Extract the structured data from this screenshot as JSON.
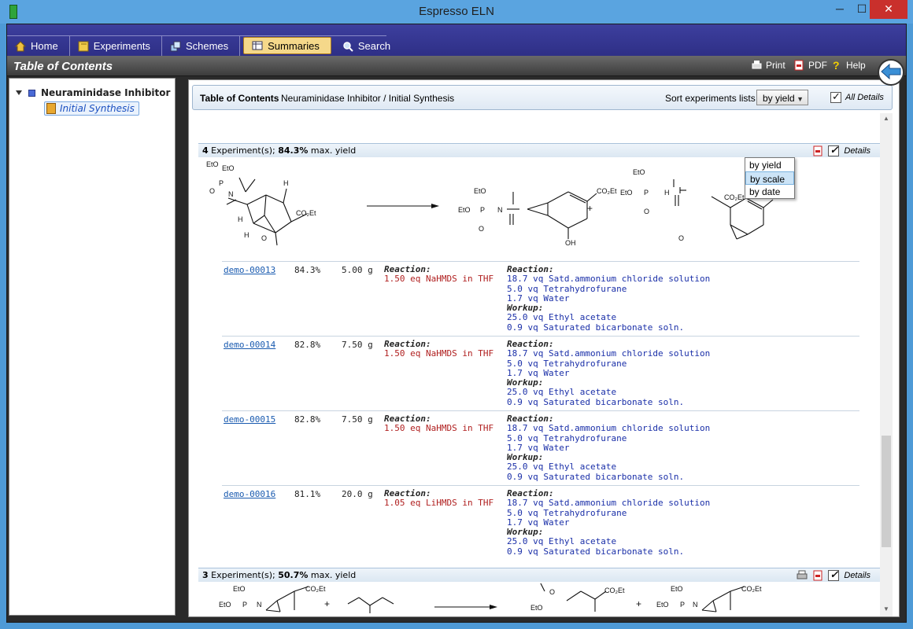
{
  "window": {
    "title": "Espresso ELN",
    "min": "─",
    "max": "☐",
    "close": "✕"
  },
  "nav": {
    "tabs": [
      {
        "label": "Home"
      },
      {
        "label": "Experiments"
      },
      {
        "label": "Schemes"
      },
      {
        "label": "Summaries"
      },
      {
        "label": "Search"
      }
    ],
    "active_tab": "Summaries"
  },
  "toolbar": {
    "title": "Table of Contents",
    "print": "Print",
    "pdf": "PDF",
    "help": "Help"
  },
  "tree": {
    "root": "Neuraminidase Inhibitor",
    "child": "Initial Synthesis"
  },
  "toc_bar": {
    "label": "Table of Contents",
    "path": "Neuraminidase Inhibitor / Initial Synthesis",
    "sort_label": "Sort experiments lists",
    "sort_value": "by yield",
    "all_details": "All Details"
  },
  "sort_options": [
    "by yield",
    "by scale",
    "by date"
  ],
  "groups": [
    {
      "count": "4",
      "count_suffix": "Experiment(s);",
      "yield": "84.3%",
      "yield_suffix": "max. yield",
      "details": "Details",
      "experiments": [
        {
          "id": "demo-00013",
          "yield": "84.3%",
          "scale": "5.00 g",
          "reaction_label": "Reaction:",
          "reaction": "1.50 eq NaHMDS in THF",
          "quench_label": "Reaction:",
          "quench": [
            "18.7 vq Satd.ammonium chloride solution",
            "5.0 vq Tetrahydrofurane",
            "1.7 vq Water"
          ],
          "workup_label": "Workup:",
          "workup": [
            "25.0 vq Ethyl acetate",
            "0.9 vq Saturated bicarbonate soln."
          ]
        },
        {
          "id": "demo-00014",
          "yield": "82.8%",
          "scale": "7.50 g",
          "reaction_label": "Reaction:",
          "reaction": "1.50 eq NaHMDS in THF",
          "quench_label": "Reaction:",
          "quench": [
            "18.7 vq Satd.ammonium chloride solution",
            "5.0 vq Tetrahydrofurane",
            "1.7 vq Water"
          ],
          "workup_label": "Workup:",
          "workup": [
            "25.0 vq Ethyl acetate",
            "0.9 vq Saturated bicarbonate soln."
          ]
        },
        {
          "id": "demo-00015",
          "yield": "82.8%",
          "scale": "7.50 g",
          "reaction_label": "Reaction:",
          "reaction": "1.50 eq NaHMDS in THF",
          "quench_label": "Reaction:",
          "quench": [
            "18.7 vq Satd.ammonium chloride solution",
            "5.0 vq Tetrahydrofurane",
            "1.7 vq Water"
          ],
          "workup_label": "Workup:",
          "workup": [
            "25.0 vq Ethyl acetate",
            "0.9 vq Saturated bicarbonate soln."
          ]
        },
        {
          "id": "demo-00016",
          "yield": "81.1%",
          "scale": "20.0 g",
          "reaction_label": "Reaction:",
          "reaction": "1.05 eq LiHMDS in THF",
          "quench_label": "Reaction:",
          "quench": [
            "18.7 vq Satd.ammonium chloride solution",
            "5.0 vq Tetrahydrofurane",
            "1.7 vq Water"
          ],
          "workup_label": "Workup:",
          "workup": [
            "25.0 vq Ethyl acetate",
            "0.9 vq Saturated bicarbonate soln."
          ]
        }
      ]
    },
    {
      "count": "3",
      "count_suffix": "Experiment(s);",
      "yield": "50.7%",
      "yield_suffix": "max. yield",
      "details": "Details"
    }
  ],
  "chem_labels": {
    "eto": "EtO",
    "p": "P",
    "o": "O",
    "n": "N",
    "h": "H",
    "co2et": "CO₂Et",
    "oh": "OH",
    "nh": "H",
    "plus": "+"
  },
  "colors": {
    "accent": "#2e2f86",
    "active_tab": "#f5d88a",
    "link": "#1a5bb0",
    "reaction_red": "#b02020",
    "quench_blue": "#1a2fa8"
  }
}
